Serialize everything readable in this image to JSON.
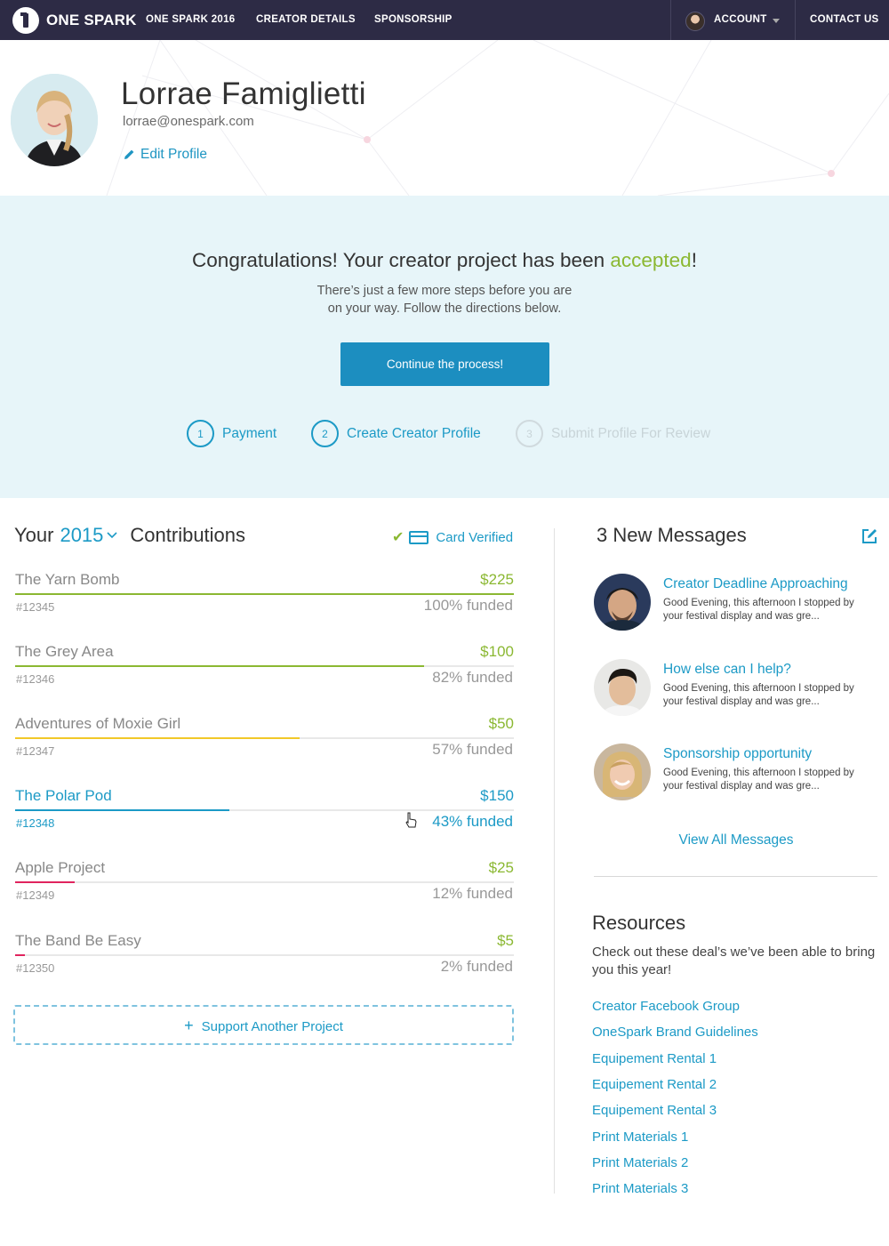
{
  "nav": {
    "brand": "ONE SPARK",
    "links": [
      "ONE SPARK 2016",
      "CREATOR DETAILS",
      "SPONSORSHIP"
    ],
    "account_label": "ACCOUNT",
    "contact_label": "CONTACT US"
  },
  "profile": {
    "name": "Lorrae Famiglietti",
    "email": "lorrae@onespark.com",
    "edit_label": "Edit Profile"
  },
  "banner": {
    "headline_prefix": "Congratulations! Your creator project has been ",
    "headline_accent": "accepted",
    "headline_suffix": "!",
    "sub_line1": "There’s just a few more steps before you are",
    "sub_line2": "on your way. Follow the directions below.",
    "cta_label": "Continue the process!",
    "steps": [
      {
        "num": "1",
        "label": "Payment",
        "state": "active"
      },
      {
        "num": "2",
        "label": "Create Creator Profile",
        "state": "active"
      },
      {
        "num": "3",
        "label": "Submit Profile For Review",
        "state": "inactive"
      }
    ]
  },
  "contributions": {
    "heading_prefix": "Your",
    "year": "2015",
    "heading_suffix": "Contributions",
    "card_status": "Card Verified",
    "rows": [
      {
        "name": "The Yarn Bomb",
        "amount": "$225",
        "id": "#12345",
        "funded_label": "100% funded",
        "funded": 1.0,
        "color": "#8bb832"
      },
      {
        "name": "The Grey Area",
        "amount": "$100",
        "id": "#12346",
        "funded_label": "82% funded",
        "funded": 0.82,
        "color": "#8bb832"
      },
      {
        "name": "Adventures of Moxie Girl",
        "amount": "$50",
        "id": "#12347",
        "funded_label": "57% funded",
        "funded": 0.57,
        "color": "#f2c829"
      },
      {
        "name": "The Polar Pod",
        "amount": "$150",
        "id": "#12348",
        "funded_label": "43% funded",
        "funded": 0.43,
        "color": "#1c9ac6"
      },
      {
        "name": "Apple Project",
        "amount": "$25",
        "id": "#12349",
        "funded_label": "12% funded",
        "funded": 0.12,
        "color": "#e0245e"
      },
      {
        "name": "The Band Be Easy",
        "amount": "$5",
        "id": "#12350",
        "funded_label": "2% funded",
        "funded": 0.02,
        "color": "#e0245e"
      }
    ],
    "support_label": "Support Another Project"
  },
  "messages": {
    "heading": "3 New Messages",
    "items": [
      {
        "title": "Creator Deadline Approaching",
        "preview": "Good Evening, this afternoon I stopped by your festival display and was gre..."
      },
      {
        "title": "How else can I help?",
        "preview": "Good Evening, this afternoon I stopped by your festival display and was gre..."
      },
      {
        "title": "Sponsorship opportunity",
        "preview": "Good Evening, this afternoon I stopped by your festival display and was gre..."
      }
    ],
    "view_all": "View All Messages"
  },
  "resources": {
    "heading": "Resources",
    "description": "Check out these deal’s we’ve been able to bring you this year!",
    "links": [
      "Creator Facebook Group",
      "OneSpark Brand Guidelines",
      "Equipement Rental 1",
      "Equipement Rental 2",
      "Equipement Rental 3",
      "Print Materials 1",
      "Print Materials 2",
      "Print Materials 3"
    ]
  }
}
